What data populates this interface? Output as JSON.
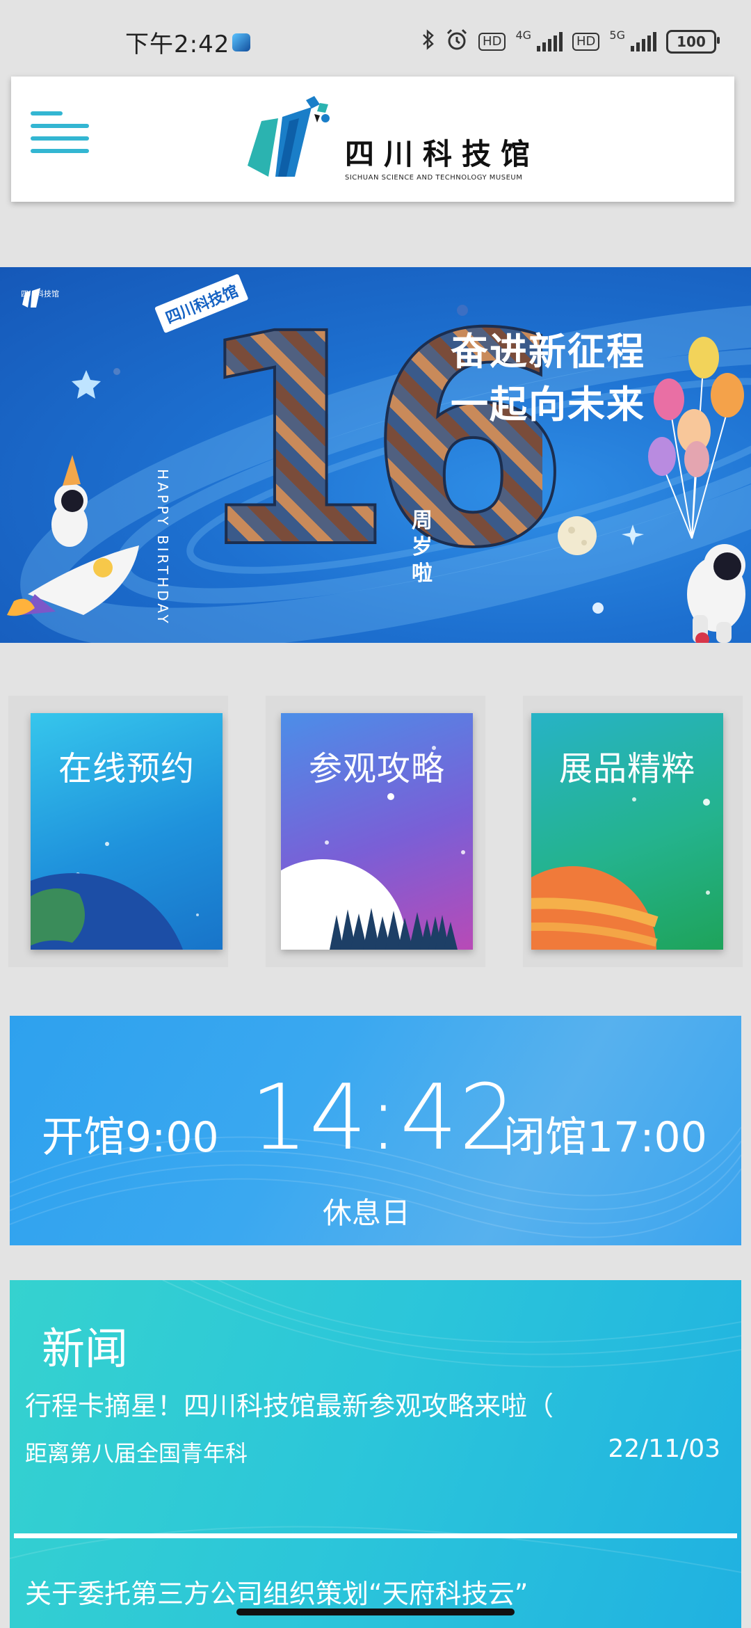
{
  "status_bar": {
    "time": "下午2:42",
    "network_1": "4G",
    "network_2": "5G",
    "hd": "HD",
    "battery": "100"
  },
  "header": {
    "logo_text_cn": "四川科技馆",
    "logo_text_en": "SICHUAN SCIENCE AND TECHNOLOGY MUSEUM"
  },
  "banner": {
    "corner_logo": "四川科技馆",
    "tag": "四川科技馆",
    "big_number": "16",
    "happy_birthday": "HAPPY BIRTHDAY",
    "age_text": "周岁啦",
    "slogan_line1": "奋进新征程",
    "slogan_line2": "一起向未来"
  },
  "tiles": [
    {
      "label": "在线预约"
    },
    {
      "label": "参观攻略"
    },
    {
      "label": "展品精粹"
    }
  ],
  "hours": {
    "open": "开馆9:00",
    "current_time": "14:42",
    "close": "闭馆17:00",
    "status": "休息日"
  },
  "news": {
    "title": "新闻",
    "items": [
      {
        "title": "行程卡摘星！四川科技馆最新参观攻略来啦（",
        "subtitle": "距离第八届全国青年科",
        "date": "22/11/03"
      },
      {
        "title": "关于委托第三方公司组织策划“天府科技云”",
        "subtitle": "",
        "date": ""
      }
    ]
  },
  "colors": {
    "accent": "#33b6d2",
    "banner_blue": "#1d70d0",
    "hours_blue": "#3aa8f0",
    "news_teal": "#2bc5da"
  }
}
